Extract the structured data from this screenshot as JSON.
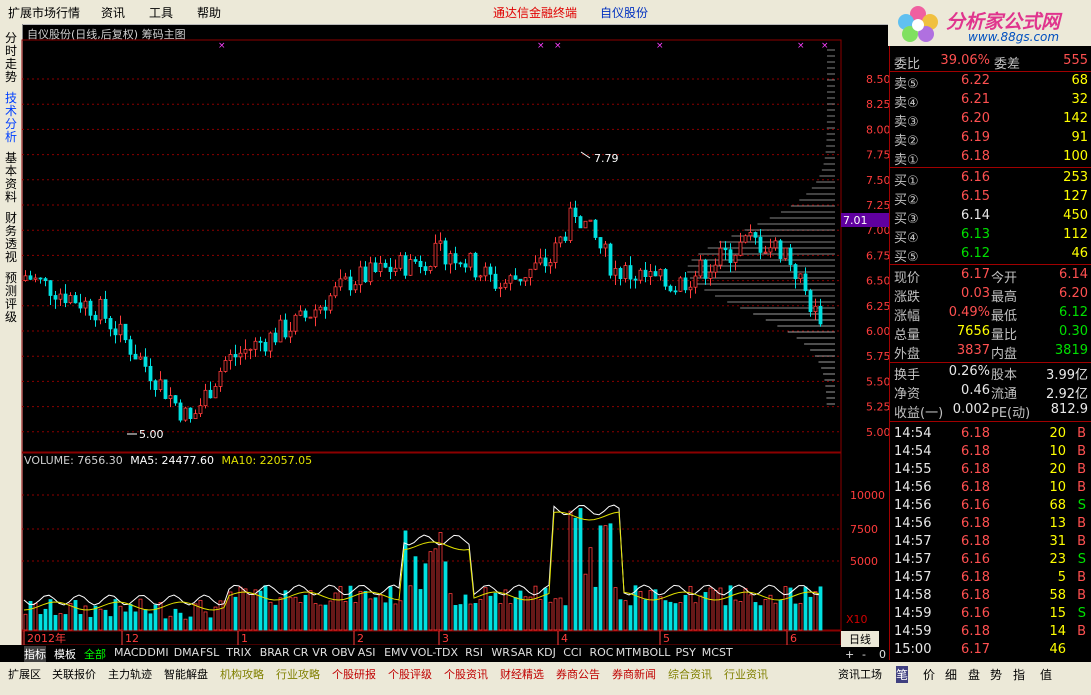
{
  "menu": {
    "items": [
      "扩展市场行情",
      "资讯",
      "工具",
      "帮助"
    ],
    "brand": "通达信金融终端",
    "stock": "自仪股份"
  },
  "logo": {
    "title": "分析家公式网",
    "url": "www.88gs.com"
  },
  "left_tabs": [
    "分时走势",
    "技术分析",
    "基本资料",
    "财务透视",
    "预测评级"
  ],
  "chart_title": "自仪股份(日线,后复权) 筹码主图",
  "price_labels": {
    "high": "7.79",
    "low": "5.00",
    "current_marker": "7.01"
  },
  "volume_info": {
    "label": "VOLUME: 7656.30",
    "ma5": "MA5: 24477.60",
    "ma10": "MA10: 22057.05"
  },
  "price_axis": [
    "8.50",
    "8.25",
    "8.00",
    "7.75",
    "7.50",
    "7.25",
    "7.00",
    "6.75",
    "6.50",
    "6.25",
    "6.00",
    "5.75",
    "5.50",
    "5.25",
    "5.00"
  ],
  "volume_axis": [
    "10000",
    "7500",
    "5000"
  ],
  "time_axis": [
    "2012年",
    "12",
    "1",
    "2",
    "3",
    "4",
    "5",
    "6"
  ],
  "quote": {
    "top": {
      "l1": "委比",
      "v1": "39.06%",
      "l2": "委差",
      "v2": "555"
    },
    "sells": [
      {
        "label": "卖⑤",
        "price": "6.22",
        "vol": "68"
      },
      {
        "label": "卖④",
        "price": "6.21",
        "vol": "32"
      },
      {
        "label": "卖③",
        "price": "6.20",
        "vol": "142"
      },
      {
        "label": "卖②",
        "price": "6.19",
        "vol": "91"
      },
      {
        "label": "卖①",
        "price": "6.18",
        "vol": "100"
      }
    ],
    "buys": [
      {
        "label": "买①",
        "price": "6.16",
        "vol": "253"
      },
      {
        "label": "买②",
        "price": "6.15",
        "vol": "127"
      },
      {
        "label": "买③",
        "price": "6.14",
        "vol": "450"
      },
      {
        "label": "买④",
        "price": "6.13",
        "vol": "112"
      },
      {
        "label": "买⑤",
        "price": "6.12",
        "vol": "46"
      }
    ],
    "stats": [
      {
        "l1": "现价",
        "v1": "6.17",
        "l2": "今开",
        "v2": "6.14"
      },
      {
        "l1": "涨跌",
        "v1": "0.03",
        "l2": "最高",
        "v2": "6.20"
      },
      {
        "l1": "涨幅",
        "v1": "0.49%",
        "l2": "最低",
        "v2": "6.12"
      },
      {
        "l1": "总量",
        "v1": "7656",
        "l2": "量比",
        "v2": "0.30"
      },
      {
        "l1": "外盘",
        "v1": "3837",
        "l2": "内盘",
        "v2": "3819"
      }
    ],
    "fund": [
      {
        "l1": "换手",
        "v1": "0.26%",
        "l2": "股本",
        "v2": "3.99亿"
      },
      {
        "l1": "净资",
        "v1": "0.46",
        "l2": "流通",
        "v2": "2.92亿"
      },
      {
        "l1": "收益(一)",
        "v1": "0.002",
        "l2": "PE(动)",
        "v2": "812.9"
      }
    ]
  },
  "ticks": [
    {
      "t": "14:54",
      "p": "6.18",
      "v": "20",
      "d": "B"
    },
    {
      "t": "14:54",
      "p": "6.18",
      "v": "10",
      "d": "B"
    },
    {
      "t": "14:55",
      "p": "6.18",
      "v": "20",
      "d": "B"
    },
    {
      "t": "14:56",
      "p": "6.18",
      "v": "10",
      "d": "B"
    },
    {
      "t": "14:56",
      "p": "6.16",
      "v": "68",
      "d": "S"
    },
    {
      "t": "14:56",
      "p": "6.18",
      "v": "13",
      "d": "B"
    },
    {
      "t": "14:57",
      "p": "6.18",
      "v": "31",
      "d": "B"
    },
    {
      "t": "14:57",
      "p": "6.16",
      "v": "23",
      "d": "S"
    },
    {
      "t": "14:57",
      "p": "6.18",
      "v": "5",
      "d": "B"
    },
    {
      "t": "14:58",
      "p": "6.18",
      "v": "58",
      "d": "B"
    },
    {
      "t": "14:59",
      "p": "6.16",
      "v": "15",
      "d": "S"
    },
    {
      "t": "14:59",
      "p": "6.18",
      "v": "14",
      "d": "B"
    },
    {
      "t": "15:00",
      "p": "6.17",
      "v": "46",
      "d": ""
    }
  ],
  "indicator_tabs": [
    "指标",
    "模板",
    "全部",
    "MACD",
    "DMI",
    "DMA",
    "FSL",
    "TRIX",
    "BRAR",
    "CR",
    "VR",
    "OBV",
    "ASI",
    "EMV",
    "VOL-TDX",
    "RSI",
    "WR",
    "SAR",
    "KDJ",
    "CCI",
    "ROC",
    "MTM",
    "BOLL",
    "PSY",
    "MCST"
  ],
  "period": "日线",
  "x10": "X10",
  "zoom_buttons": [
    "+",
    "-",
    "0"
  ],
  "bottom_tabs": [
    "扩展区",
    "关联报价",
    "主力轨迹",
    "智能解盘",
    "机构攻略",
    "行业攻略",
    "个股研报",
    "个股评级",
    "个股资讯",
    "财经精选",
    "券商公告",
    "券商新闻",
    "综合资讯",
    "行业资讯",
    "资讯工场"
  ],
  "right_bottom_tabs": [
    "笔",
    "价",
    "细",
    "盘",
    "势",
    "指",
    "值"
  ],
  "colors": {
    "up": "#ff3c3c",
    "down": "#00e0e0",
    "ma5": "#ffffff",
    "ma10": "#e0e000",
    "bg": "#000000",
    "grid": "#8b0000"
  }
}
